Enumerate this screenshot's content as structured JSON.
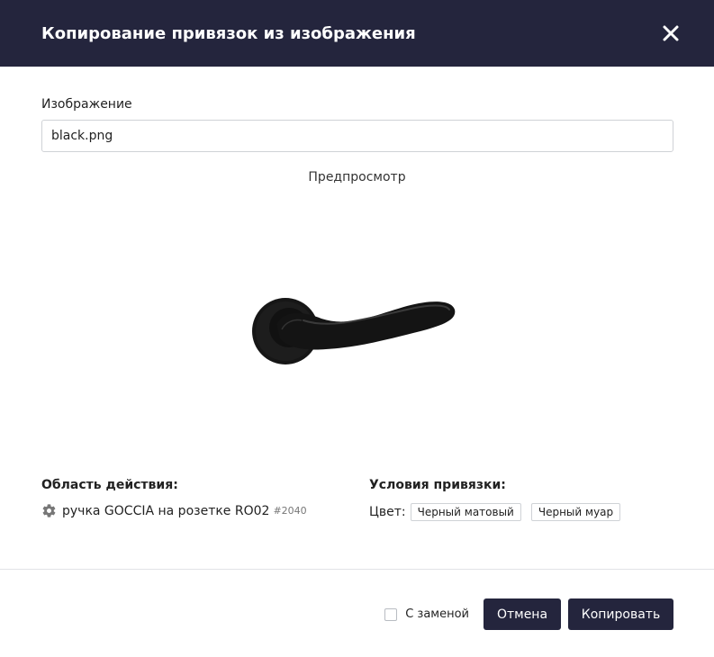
{
  "header": {
    "title": "Копирование привязок из изображения",
    "close_icon": "close-icon"
  },
  "image_field": {
    "label": "Изображение",
    "value": "black.png"
  },
  "preview": {
    "title": "Предпросмотр",
    "image": "black-door-handle"
  },
  "scope": {
    "heading": "Область действия:",
    "item_label": "ручка GOCCIA на розетке RO02",
    "item_id": "#2040",
    "item_icon": "gear-icon"
  },
  "conditions": {
    "heading": "Условия привязки:",
    "color_label": "Цвет:",
    "tags": [
      "Черный матовый",
      "Черный муар"
    ]
  },
  "footer": {
    "replace_label": "С заменой",
    "replace_checked": false,
    "cancel_label": "Отмена",
    "copy_label": "Копировать"
  },
  "colors": {
    "header_bg": "#24253d",
    "button_bg": "#24253d",
    "header_text": "#ffffff"
  }
}
